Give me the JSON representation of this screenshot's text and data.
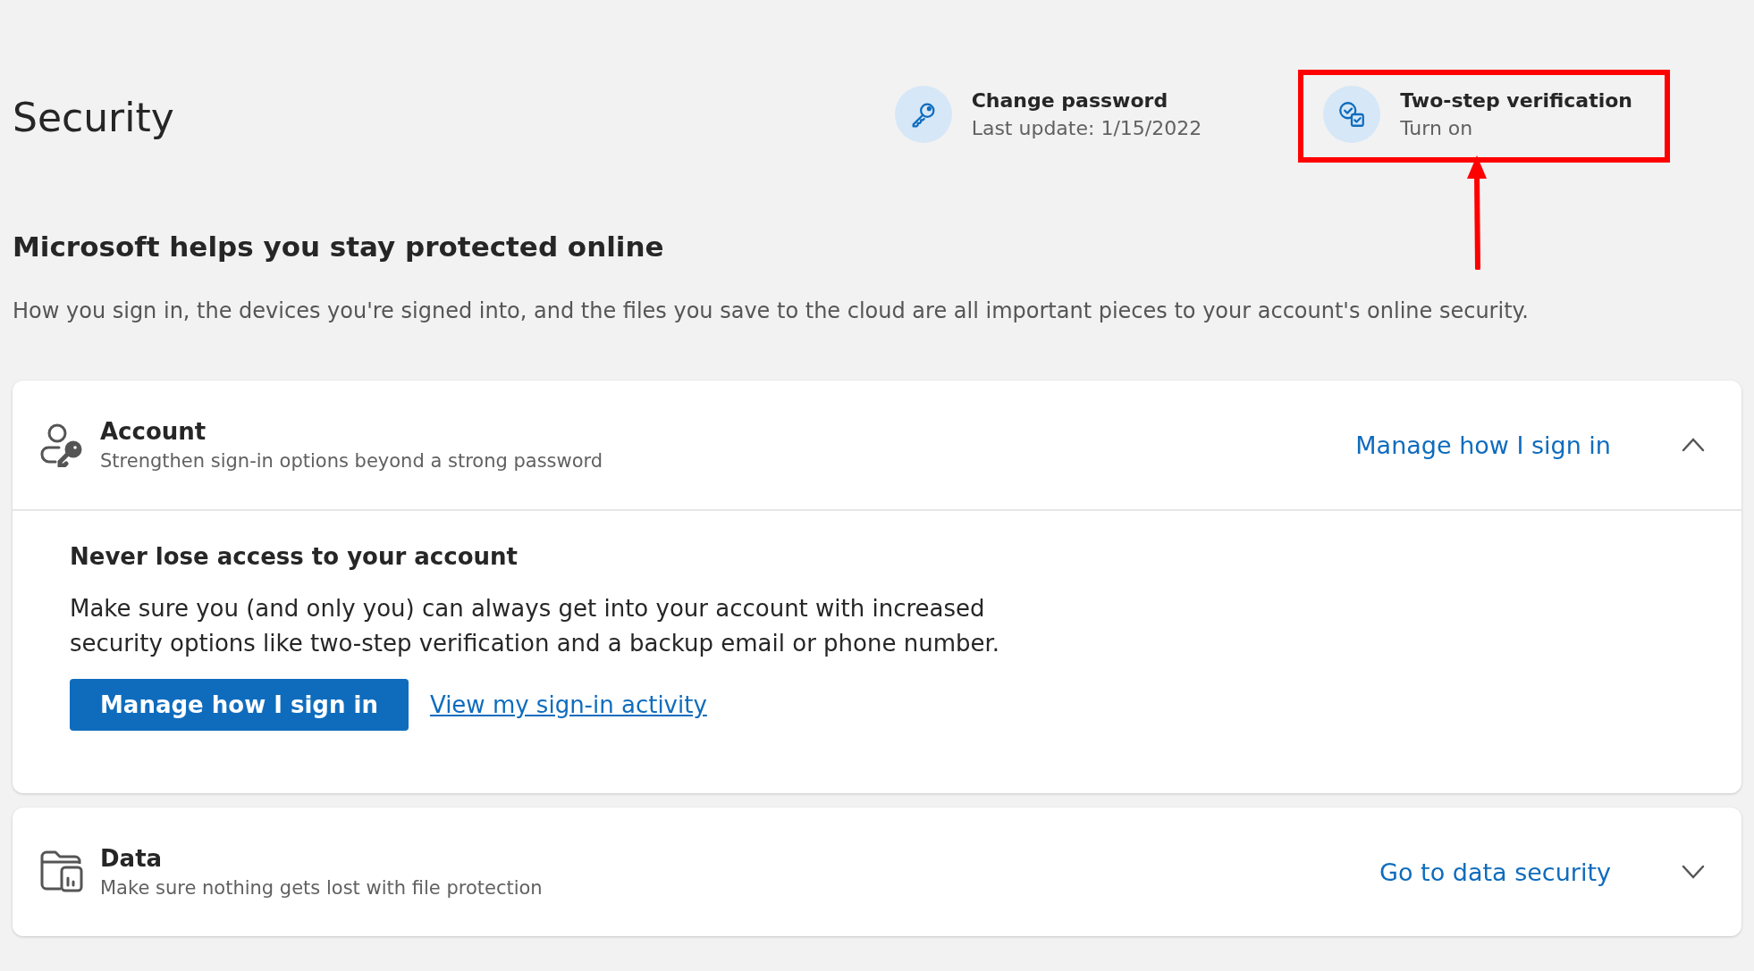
{
  "title": "Security",
  "quick_actions": [
    {
      "kind": "key",
      "title": "Change password",
      "subtitle": "Last update: 1/15/2022",
      "highlighted": false
    },
    {
      "kind": "verify",
      "title": "Two-step verification",
      "subtitle": "Turn on",
      "highlighted": true
    }
  ],
  "heading": "Microsoft helps you stay protected online",
  "description": "How you sign in, the devices you're signed into, and the files you save to the cloud are all important pieces to your account's online security.",
  "sections": [
    {
      "kind": "account",
      "title": "Account",
      "subtitle": "Strengthen sign-in options beyond a strong password",
      "link": "Manage how I sign in",
      "expanded": true,
      "body": {
        "heading": "Never lose access to your account",
        "text": "Make sure you (and only you) can always get into your account with increased security options like two-step verification and a backup email or phone number.",
        "button": "Manage how I sign in",
        "link": "View my sign-in activity"
      }
    },
    {
      "kind": "data",
      "title": "Data",
      "subtitle": "Make sure nothing gets lost with file protection",
      "link": "Go to data security",
      "expanded": false
    }
  ]
}
